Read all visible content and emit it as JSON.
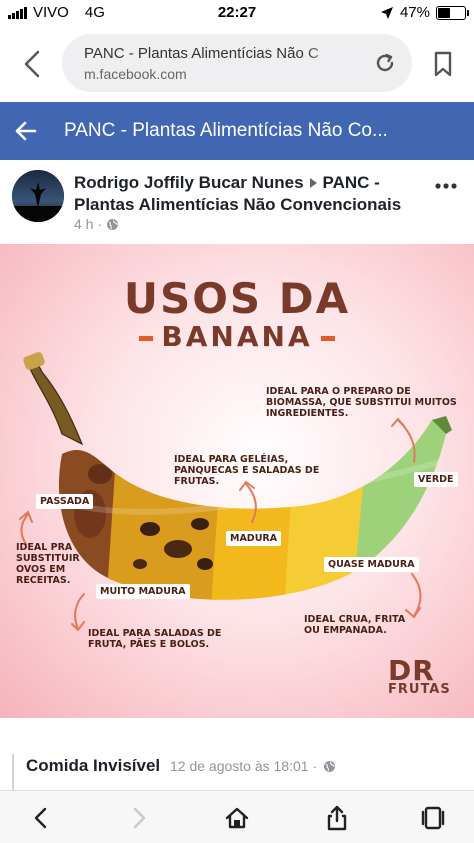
{
  "status_bar": {
    "carrier": "VIVO",
    "network": "4G",
    "time": "22:27",
    "battery_percent": "47%",
    "battery_level": 0.47
  },
  "browser": {
    "page_title": "PANC - Plantas Alimentícias Não C",
    "domain": "m.facebook.com"
  },
  "fb_header": {
    "title": "PANC - Plantas Alimentícias Não Co..."
  },
  "post": {
    "author": "Rodrigo Joffily Bucar Nunes",
    "group": "PANC - Plantas Alimentícias Não Convencionais",
    "time": "4 h ·"
  },
  "infographic": {
    "title": "USOS DA",
    "subtitle": "BANANA",
    "stages": {
      "passada": "PASSADA",
      "muito_madura": "MUITO MADURA",
      "madura": "MADURA",
      "quase_madura": "QUASE MADURA",
      "verde": "VERDE"
    },
    "uses": {
      "passada": "IDEAL PRA SUBSTITUIR OVOS EM RECEITAS.",
      "muito_madura": "IDEAL PARA SALADAS DE FRUTA, PÃES E BOLOS.",
      "madura": "IDEAL PARA GELÉIAS, PANQUECAS E SALADAS DE FRUTAS.",
      "quase_madura": "IDEAL CRUA, FRITA OU EMPANADA.",
      "verde": "IDEAL PARA O PREPARO DE BIOMASSA, QUE SUBSTITUI MUITOS INGREDIENTES."
    },
    "brand": {
      "line1": "DR",
      "line2": "FRUTAS"
    },
    "colors": {
      "green": "#9ed27a",
      "yellow": "#f2b81c",
      "brown": "#8a4a22",
      "arrow": "#e07a5a"
    }
  },
  "comment": {
    "author": "Comida Invisível",
    "date": "12 de agosto às 18:01 ·"
  },
  "toolbar": {
    "icons": [
      "back-icon",
      "forward-icon",
      "home-icon",
      "share-icon",
      "tabs-icon"
    ]
  }
}
